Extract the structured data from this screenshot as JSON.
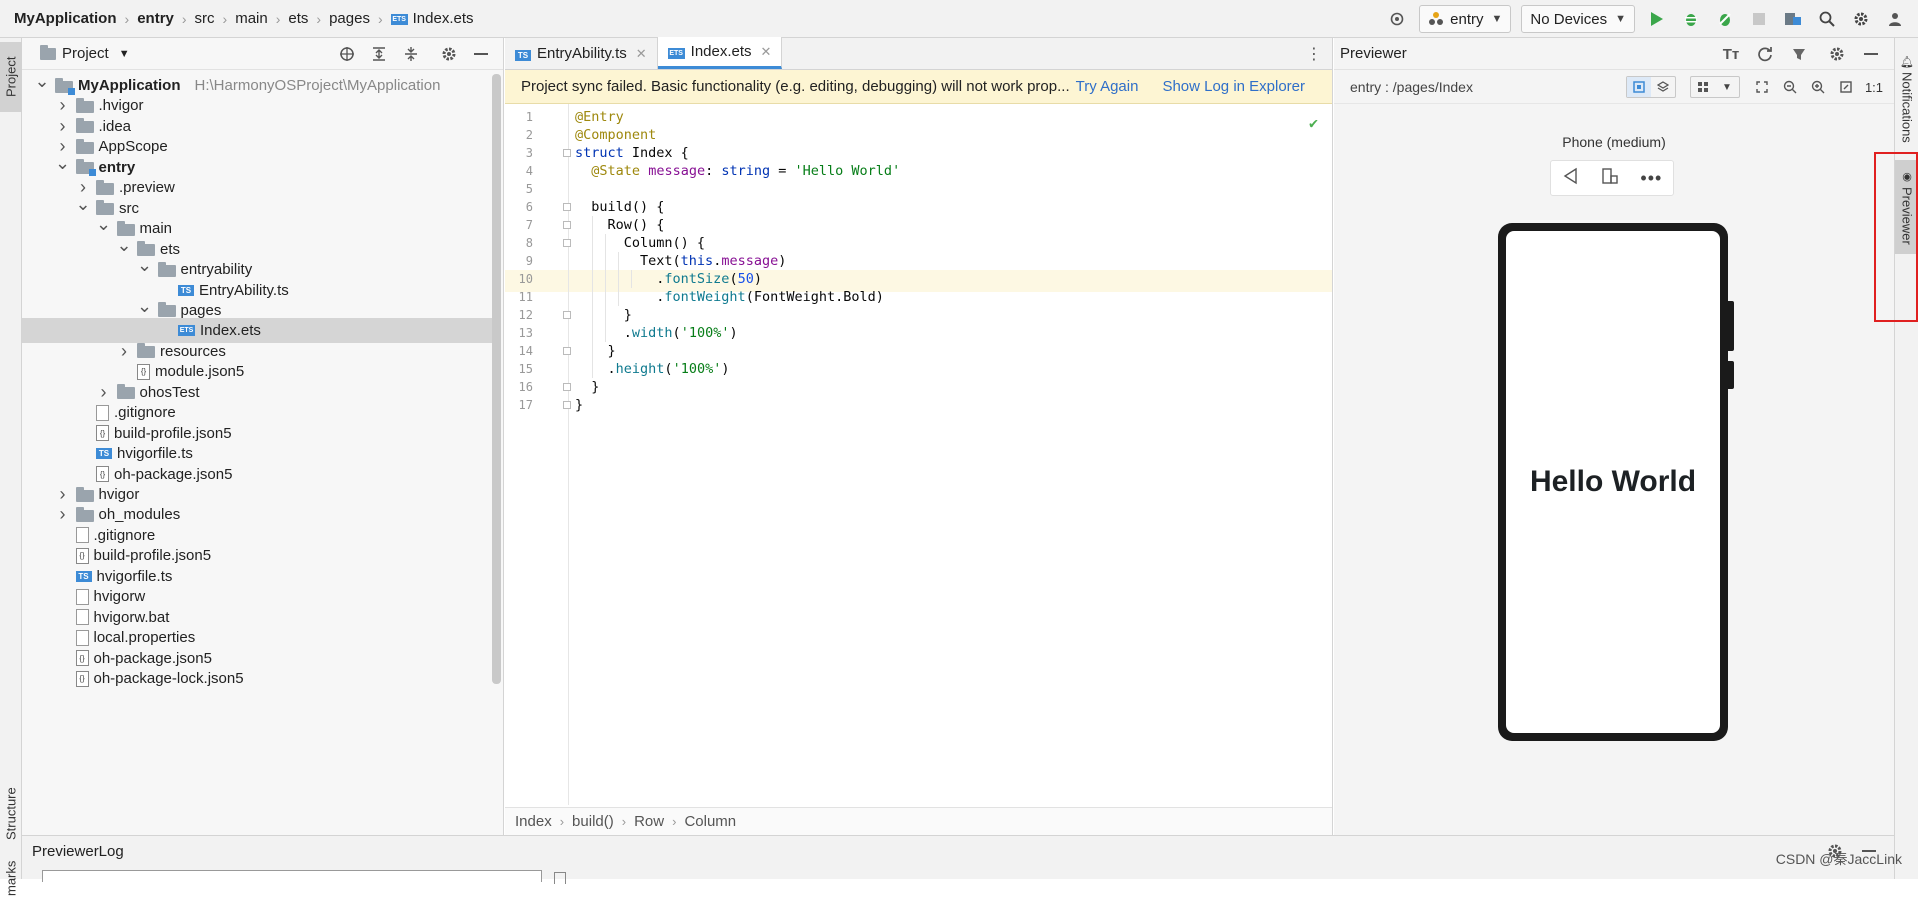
{
  "topbar": {
    "breadcrumbs": [
      "MyApplication",
      "entry",
      "src",
      "main",
      "ets",
      "pages",
      "Index.ets"
    ],
    "module_select": "entry",
    "device_select": "No Devices"
  },
  "left_stripe": {
    "project_tab": "Project",
    "structure_tab": "Structure",
    "bookmarks_tab": "marks"
  },
  "project": {
    "title": "Project",
    "tree": [
      {
        "label": "MyApplication",
        "path": "H:\\HarmonyOSProject\\MyApplication",
        "depth": 0,
        "arrow": "open",
        "icon": "folder-module",
        "bold": true
      },
      {
        "label": ".hvigor",
        "depth": 1,
        "arrow": "closed",
        "icon": "folder"
      },
      {
        "label": ".idea",
        "depth": 1,
        "arrow": "closed",
        "icon": "folder"
      },
      {
        "label": "AppScope",
        "depth": 1,
        "arrow": "closed",
        "icon": "folder"
      },
      {
        "label": "entry",
        "depth": 1,
        "arrow": "open",
        "icon": "folder-module",
        "bold": true
      },
      {
        "label": ".preview",
        "depth": 2,
        "arrow": "closed",
        "icon": "folder"
      },
      {
        "label": "src",
        "depth": 2,
        "arrow": "open",
        "icon": "folder"
      },
      {
        "label": "main",
        "depth": 3,
        "arrow": "open",
        "icon": "folder"
      },
      {
        "label": "ets",
        "depth": 4,
        "arrow": "open",
        "icon": "folder"
      },
      {
        "label": "entryability",
        "depth": 5,
        "arrow": "open",
        "icon": "folder"
      },
      {
        "label": "EntryAbility.ts",
        "depth": 6,
        "arrow": "none",
        "icon": "ts"
      },
      {
        "label": "pages",
        "depth": 5,
        "arrow": "open",
        "icon": "folder"
      },
      {
        "label": "Index.ets",
        "depth": 6,
        "arrow": "none",
        "icon": "ets",
        "selected": true
      },
      {
        "label": "resources",
        "depth": 4,
        "arrow": "closed",
        "icon": "folder"
      },
      {
        "label": "module.json5",
        "depth": 4,
        "arrow": "none",
        "icon": "json"
      },
      {
        "label": "ohosTest",
        "depth": 3,
        "arrow": "closed",
        "icon": "folder"
      },
      {
        "label": ".gitignore",
        "depth": 2,
        "arrow": "none",
        "icon": "file"
      },
      {
        "label": "build-profile.json5",
        "depth": 2,
        "arrow": "none",
        "icon": "json"
      },
      {
        "label": "hvigorfile.ts",
        "depth": 2,
        "arrow": "none",
        "icon": "ts"
      },
      {
        "label": "oh-package.json5",
        "depth": 2,
        "arrow": "none",
        "icon": "json"
      },
      {
        "label": "hvigor",
        "depth": 1,
        "arrow": "closed",
        "icon": "folder"
      },
      {
        "label": "oh_modules",
        "depth": 1,
        "arrow": "closed",
        "icon": "folder"
      },
      {
        "label": ".gitignore",
        "depth": 1,
        "arrow": "none",
        "icon": "file"
      },
      {
        "label": "build-profile.json5",
        "depth": 1,
        "arrow": "none",
        "icon": "json"
      },
      {
        "label": "hvigorfile.ts",
        "depth": 1,
        "arrow": "none",
        "icon": "ts"
      },
      {
        "label": "hvigorw",
        "depth": 1,
        "arrow": "none",
        "icon": "file"
      },
      {
        "label": "hvigorw.bat",
        "depth": 1,
        "arrow": "none",
        "icon": "file"
      },
      {
        "label": "local.properties",
        "depth": 1,
        "arrow": "none",
        "icon": "file"
      },
      {
        "label": "oh-package.json5",
        "depth": 1,
        "arrow": "none",
        "icon": "json"
      },
      {
        "label": "oh-package-lock.json5",
        "depth": 1,
        "arrow": "none",
        "icon": "json"
      }
    ]
  },
  "editor": {
    "tabs": [
      {
        "label": "EntryAbility.ts",
        "badge": "TS",
        "active": false
      },
      {
        "label": "Index.ets",
        "badge": "ETS",
        "active": true
      }
    ],
    "banner": {
      "message": "Project sync failed. Basic functionality (e.g. editing, debugging) will not work prop...",
      "try_again": "Try Again",
      "show_log": "Show Log in Explorer"
    },
    "lines": [
      {
        "n": "1",
        "code": "@Entry"
      },
      {
        "n": "2",
        "code": "@Component"
      },
      {
        "n": "3",
        "code": "struct Index {"
      },
      {
        "n": "4",
        "code": "  @State message: string = 'Hello World'"
      },
      {
        "n": "5",
        "code": ""
      },
      {
        "n": "6",
        "code": "  build() {"
      },
      {
        "n": "7",
        "code": "    Row() {"
      },
      {
        "n": "8",
        "code": "      Column() {"
      },
      {
        "n": "9",
        "code": "        Text(this.message)"
      },
      {
        "n": "10",
        "code": "          .fontSize(50)"
      },
      {
        "n": "11",
        "code": "          .fontWeight(FontWeight.Bold)"
      },
      {
        "n": "12",
        "code": "      }"
      },
      {
        "n": "13",
        "code": "      .width('100%')"
      },
      {
        "n": "14",
        "code": "    }"
      },
      {
        "n": "15",
        "code": "    .height('100%')"
      },
      {
        "n": "16",
        "code": "  }"
      },
      {
        "n": "17",
        "code": "}"
      }
    ],
    "current_line": 10,
    "breadcrumb": [
      "Index",
      "build()",
      "Row",
      "Column"
    ]
  },
  "previewer": {
    "title": "Previewer",
    "path": "entry : /pages/Index",
    "device_label": "Phone (medium)",
    "screen_text": "Hello World",
    "one_to_one": "1:1"
  },
  "right_stripe": {
    "notifications_tab": "Notifications",
    "previewer_tab": "Previewer"
  },
  "bottom": {
    "title": "PreviewerLog",
    "watermark": "CSDN @秦JaccLink"
  },
  "colors": {
    "accent": "#3d8bd6",
    "banner_bg": "#fdf5d3",
    "highlight_box": "#e02020",
    "run_green": "#3aa64a"
  }
}
